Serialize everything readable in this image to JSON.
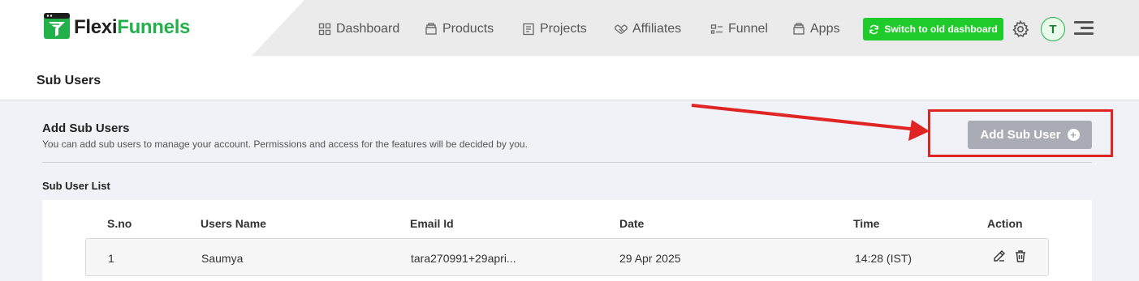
{
  "brand": {
    "part1": "Flexi",
    "part2": "Funnels",
    "accent": "#23b04a"
  },
  "nav": {
    "items": [
      {
        "label": "Dashboard",
        "icon": "dashboard-icon"
      },
      {
        "label": "Products",
        "icon": "products-icon"
      },
      {
        "label": "Projects",
        "icon": "projects-icon"
      },
      {
        "label": "Affiliates",
        "icon": "handshake-icon"
      },
      {
        "label": "Funnel",
        "icon": "funnel-icon"
      },
      {
        "label": "Apps",
        "icon": "apps-icon"
      }
    ],
    "switch_label": "Switch to old dashboard",
    "avatar_initial": "T"
  },
  "page": {
    "title": "Sub Users"
  },
  "section": {
    "title": "Add Sub Users",
    "description": "You can add sub users to manage your account. Permissions and access for the features will be decided by you.",
    "add_button": "Add Sub User",
    "list_title": "Sub User List"
  },
  "table": {
    "headers": [
      "S.no",
      "Users Name",
      "Email Id",
      "Date",
      "Time",
      "Action"
    ],
    "rows": [
      {
        "sno": "1",
        "name": "Saumya",
        "email": "tara270991+29apri...",
        "date": "29 Apr 2025",
        "time": "14:28 (IST)"
      }
    ]
  },
  "colors": {
    "switch_green": "#1fcb2a",
    "button_grey": "#a9acb4",
    "annotation_red": "#e02424"
  }
}
